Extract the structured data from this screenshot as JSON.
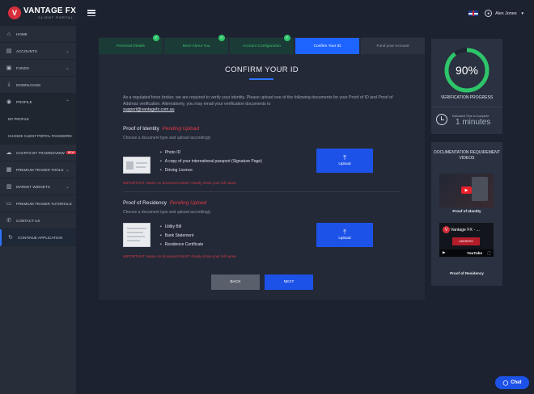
{
  "brand": {
    "name": "VANTAGE FX",
    "tagline": "CLIENT PORTAL"
  },
  "header": {
    "user_name": "Alex Jones"
  },
  "sidebar": {
    "items": [
      {
        "label": "HOME",
        "icon": "home-icon"
      },
      {
        "label": "ACCOUNTS",
        "icon": "accounts-icon"
      },
      {
        "label": "FUNDS",
        "icon": "funds-icon"
      },
      {
        "label": "DOWNLOADS",
        "icon": "download-icon"
      },
      {
        "label": "PROFILE",
        "icon": "profile-icon"
      },
      {
        "label": "MY PROFILE"
      },
      {
        "label": "CHANGE CLIENT PORTAL PASSWORD"
      },
      {
        "label": "CHARTS BY TRADINGVIEW",
        "icon": "chart-icon",
        "badge": "NEW"
      },
      {
        "label": "PREMIUM TRADER TOOLS",
        "icon": "tools-icon"
      },
      {
        "label": "MARKET WIDGETS",
        "icon": "widget-icon"
      },
      {
        "label": "PREMIUM TRADER TUTORIALS",
        "icon": "tutorial-icon"
      },
      {
        "label": "CONTACT US",
        "icon": "phone-icon"
      },
      {
        "label": "CONTINUE APPLICATION",
        "icon": "refresh-icon"
      }
    ]
  },
  "tabs": [
    {
      "label": "Personal Details",
      "state": "done"
    },
    {
      "label": "More About You",
      "state": "done"
    },
    {
      "label": "Account Configuration",
      "state": "done"
    },
    {
      "label": "Confirm Your ID",
      "state": "active"
    },
    {
      "label": "Fund your Account",
      "state": "pending"
    }
  ],
  "main": {
    "title": "CONFIRM YOUR ID",
    "intro": "As a regulated forex broker, we are required to verify your identity. Please upload one of the following documents for your Proof of ID and Proof of Address verification. Alternatively, you may email your verification documents to",
    "email": "support@vantagefx.com.au",
    "identity": {
      "title": "Proof of Identity",
      "status": "Pending Upload",
      "subtitle": "Choose a document type and upload accordingly",
      "docs": [
        "Photo ID",
        "A copy of your international passport (Signature Page)",
        "Driving Licence"
      ],
      "upload_label": "Upload",
      "warning": "IMPORTANT: Name on document MUST clearly show your full name."
    },
    "residency": {
      "title": "Proof of Residency",
      "status": "Pending Upload",
      "subtitle": "Choose a document type and upload accordingly",
      "docs": [
        "Utility Bill",
        "Bank Statement",
        "Residence Certificate"
      ],
      "upload_label": "Upload",
      "warning": "IMPORTANT: Name on document MUST clearly show your full name."
    },
    "back_label": "BACK",
    "next_label": "NEXT"
  },
  "progress": {
    "percent": 90,
    "percent_label": "90%",
    "label": "VERIFICATION PROGRESS",
    "time_caption": "Estimated Time to Complete:",
    "time_value": "1 minutes",
    "accent": "#2ec56a"
  },
  "videos": {
    "title": "DOCUMENTATION REQUIREMENT VIDEOS",
    "items": [
      {
        "caption": "Proof of Identity"
      },
      {
        "caption": "Proof of Residency",
        "thumb_title": "Vantage FX - ...",
        "thumb_banner": "ADDRESS",
        "thumb_brand": "YouTube"
      }
    ]
  },
  "chat": {
    "label": "Chat"
  }
}
